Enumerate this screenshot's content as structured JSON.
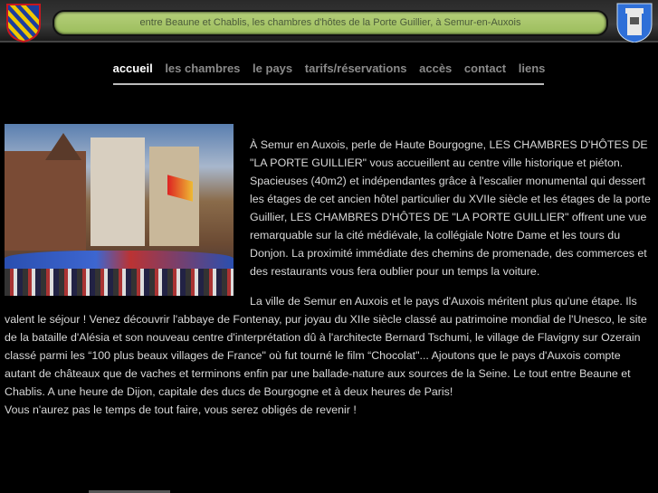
{
  "header": {
    "tagline": "entre Beaune et Chablis, les chambres d'hôtes de la Porte Guillier, à Semur-en-Auxois",
    "colors": {
      "banner": "#a8c86a",
      "burgundy_red": "#c8171e",
      "burgundy_gold": "#f0c800",
      "burgundy_blue": "#1c3c9c",
      "semur_blue": "#2e6fd8"
    }
  },
  "nav": {
    "items": [
      {
        "label": "accueil",
        "active": true
      },
      {
        "label": "les chambres"
      },
      {
        "label": "le pays"
      },
      {
        "label": "tarifs/réservations"
      },
      {
        "label": "accès"
      },
      {
        "label": "contact"
      },
      {
        "label": "liens"
      }
    ]
  },
  "content": {
    "paragraph1": "À Semur en Auxois, perle de Haute Bourgogne, LES CHAMBRES D'HÔTES DE \"LA PORTE GUILLIER\" vous accueillent au centre ville historique et piéton. Spacieuses (40m2) et indépendantes grâce à l'escalier monumental qui dessert les étages de cet ancien hôtel particulier du XVIIe siècle et les étages de la porte Guillier, LES CHAMBRES D'HÔTES DE \"LA PORTE GUILLIER\" offrent une vue remarquable sur la cité médiévale, la collégiale Notre Dame et les tours du Donjon. La proximité immédiate des chemins de promenade, des commerces et des restaurants vous fera oublier pour un temps la voiture.",
    "paragraph2": "La ville de Semur en Auxois et le pays d'Auxois méritent plus qu'une étape. Ils valent le séjour ! Venez découvrir l'abbaye de Fontenay, pur joyau du XIIe siècle classé au patrimoine mondial de l'Unesco, le site de la bataille d'Alésia et son nouveau centre d'interprétation dû à l'architecte Bernard Tschumi, le village de Flavigny sur Ozerain classé parmi les “100 plus beaux villages de France\" où fut tourné le film “Chocolat\"... Ajoutons que le pays d'Auxois compte autant de châteaux que de vaches et terminons enfin par une ballade-nature aux sources de la Seine. Le tout entre Beaune et Chablis. A une heure de Dijon, capitale des ducs de Bourgogne et à deux heures de Paris!",
    "paragraph3": "Vous n'aurez pas le temps de tout faire, vous serez obligés de revenir !"
  }
}
